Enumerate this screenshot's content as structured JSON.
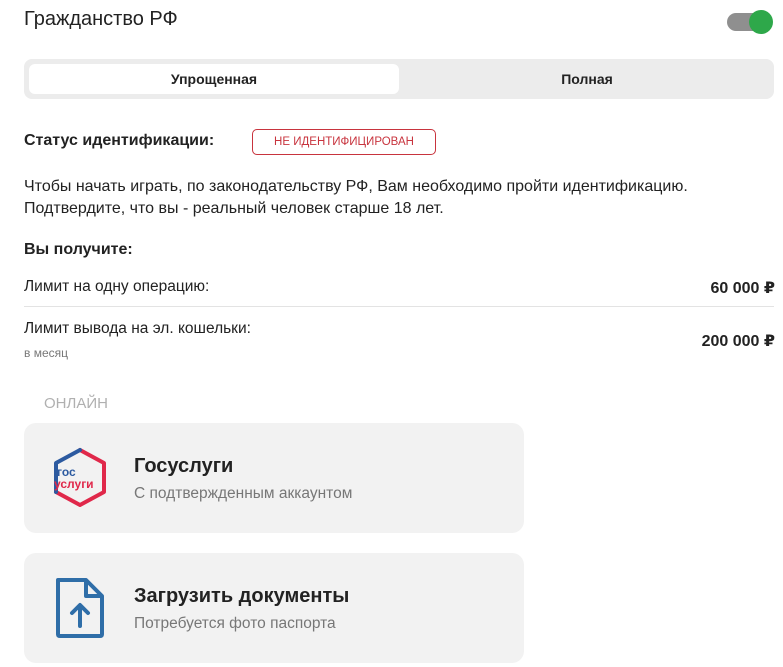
{
  "header": {
    "title": "Гражданство РФ",
    "toggle_on": true
  },
  "tabs": [
    {
      "label": "Упрощенная",
      "active": true
    },
    {
      "label": "Полная",
      "active": false
    }
  ],
  "status": {
    "label": "Статус идентификации:",
    "badge": "НЕ ИДЕНТИФИЦИРОВАН"
  },
  "description": "Чтобы начать играть, по законодательству РФ, Вам необходимо пройти идентификацию. Подтвердите, что вы - реальный человек старше 18 лет.",
  "benefits": {
    "title": "Вы получите:",
    "rows": [
      {
        "label": "Лимит на одну операцию:",
        "value": "60 000 ₽"
      },
      {
        "label": "Лимит вывода на эл. кошельки:",
        "sub": "в месяц",
        "value": "200 000 ₽"
      }
    ]
  },
  "section_label": "ОНЛАЙН",
  "options": [
    {
      "icon": "gosuslugi-logo-icon",
      "logo_text_top": "гос",
      "logo_text_bottom": "услуги",
      "title": "Госуслуги",
      "subtitle": "С подтвержденным аккаунтом"
    },
    {
      "icon": "upload-document-icon",
      "title": "Загрузить документы",
      "subtitle": "Потребуется фото паспорта"
    }
  ],
  "colors": {
    "accent_green": "#2ea84a",
    "error_red": "#c8343e",
    "gos_blue": "#2c5aa0",
    "gos_red": "#e0284a",
    "doc_blue": "#2f6ea8"
  }
}
